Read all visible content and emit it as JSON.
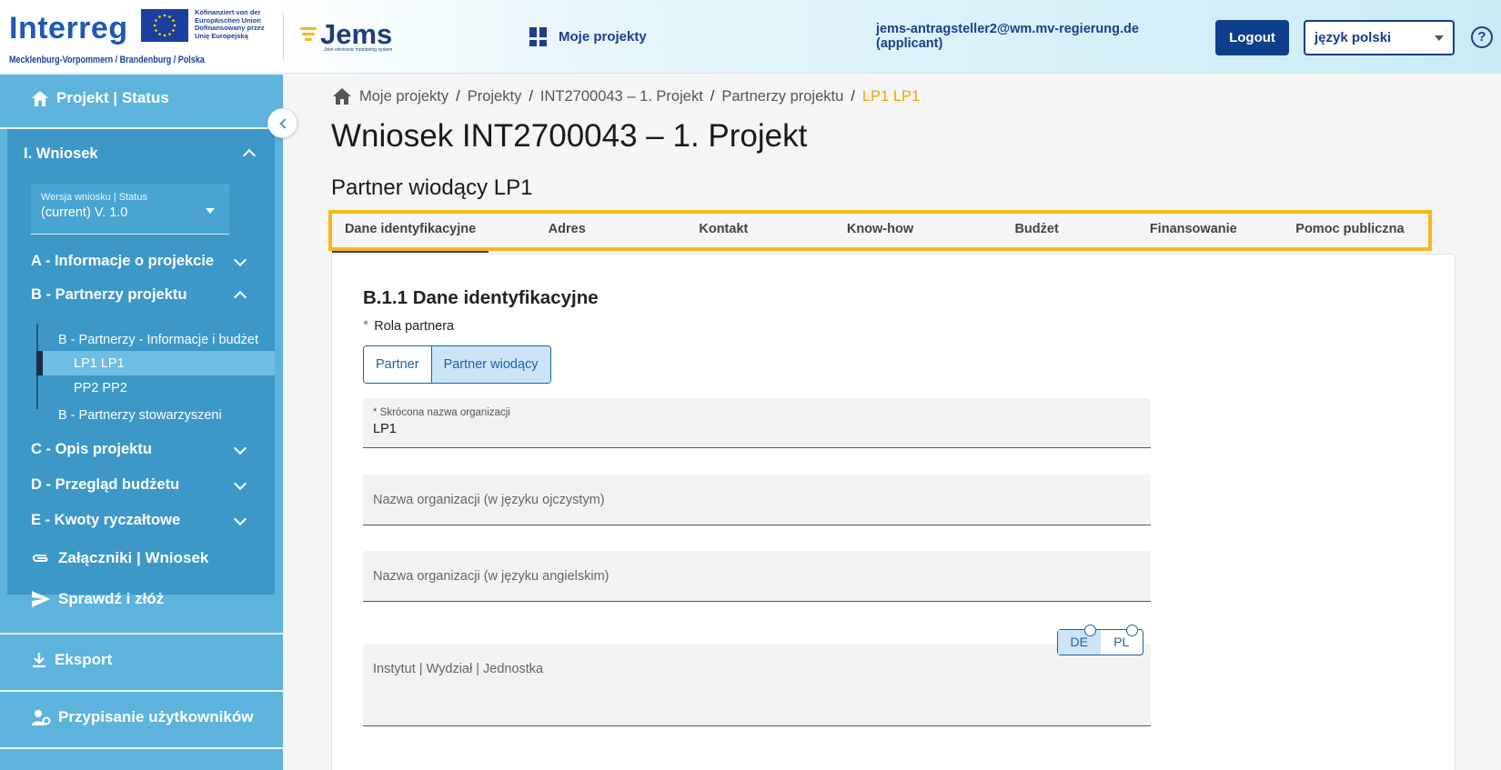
{
  "header": {
    "logo_interreg": "Interreg",
    "eu_text_lines": [
      "Kofinanziert von der",
      "Europäischen Union",
      "Dofinansowany przez",
      "Unię Europejską"
    ],
    "region": "Mecklenburg-Vorpommern / Brandenburg / Polska",
    "logo_jems": "Jems",
    "logo_jems_sub": "Joint electronic monitoring system",
    "nav_projects": "Moje projekty",
    "user_email": "jems-antragsteller2@wm.mv-regierung.de",
    "user_role": "(applicant)",
    "logout": "Logout",
    "language": "język polski",
    "help": "?"
  },
  "sidebar": {
    "project_status": "Projekt | Status",
    "section_title": "I. Wniosek",
    "version_label": "Wersja wniosku | Status",
    "version_value": "(current) V. 1.0",
    "items": [
      {
        "label": "A - Informacje o projekcie"
      },
      {
        "label": "B - Partnerzy projektu"
      },
      {
        "label": "C - Opis projektu"
      },
      {
        "label": "D - Przegląd budżetu"
      },
      {
        "label": "E - Kwoty ryczałtowe"
      }
    ],
    "b_children": {
      "info": "B - Partnerzy - Informacje i budżet",
      "lp1": "LP1 LP1",
      "pp2": "PP2 PP2",
      "associated": "B - Partnerzy stowarzyszeni"
    },
    "attachments": "Załączniki | Wniosek",
    "check_submit": "Sprawdź i złóż",
    "export": "Eksport",
    "assign_users": "Przypisanie użytkowników"
  },
  "breadcrumb": [
    "Moje projekty",
    "Projekty",
    "INT2700043 – 1. Projekt",
    "Partnerzy projektu",
    "LP1 LP1"
  ],
  "breadcrumb_sep": "/",
  "page_title": "Wniosek INT2700043 – 1. Projekt",
  "sub_title": "Partner wiodący LP1",
  "tabs": [
    "Dane identyfikacyjne",
    "Adres",
    "Kontakt",
    "Know-how",
    "Budżet",
    "Finansowanie",
    "Pomoc publiczna"
  ],
  "form": {
    "section_title": "B.1.1 Dane identyfikacyjne",
    "role_star": "*",
    "role_label": "Rola partnera",
    "role_options": [
      "Partner",
      "Partner wiodący"
    ],
    "role_selected": "Partner wiodący",
    "short_name_label": "* Skrócona nazwa organizacji",
    "short_name_value": "LP1",
    "name_native_ph": "Nazwa organizacji (w języku ojczystym)",
    "name_english_ph": "Nazwa organizacji (w języku angielskim)",
    "department_ph": "Instytut | Wydział | Jednostka",
    "lang_options": [
      "DE",
      "PL"
    ],
    "lang_selected": "DE"
  },
  "colors": {
    "sidebar": "#5eb3dd",
    "sidebar_section": "#3d98c8",
    "primary": "#0f3f8c",
    "highlight_frame": "#f4b915",
    "breadcrumb_active": "#f0a500"
  }
}
